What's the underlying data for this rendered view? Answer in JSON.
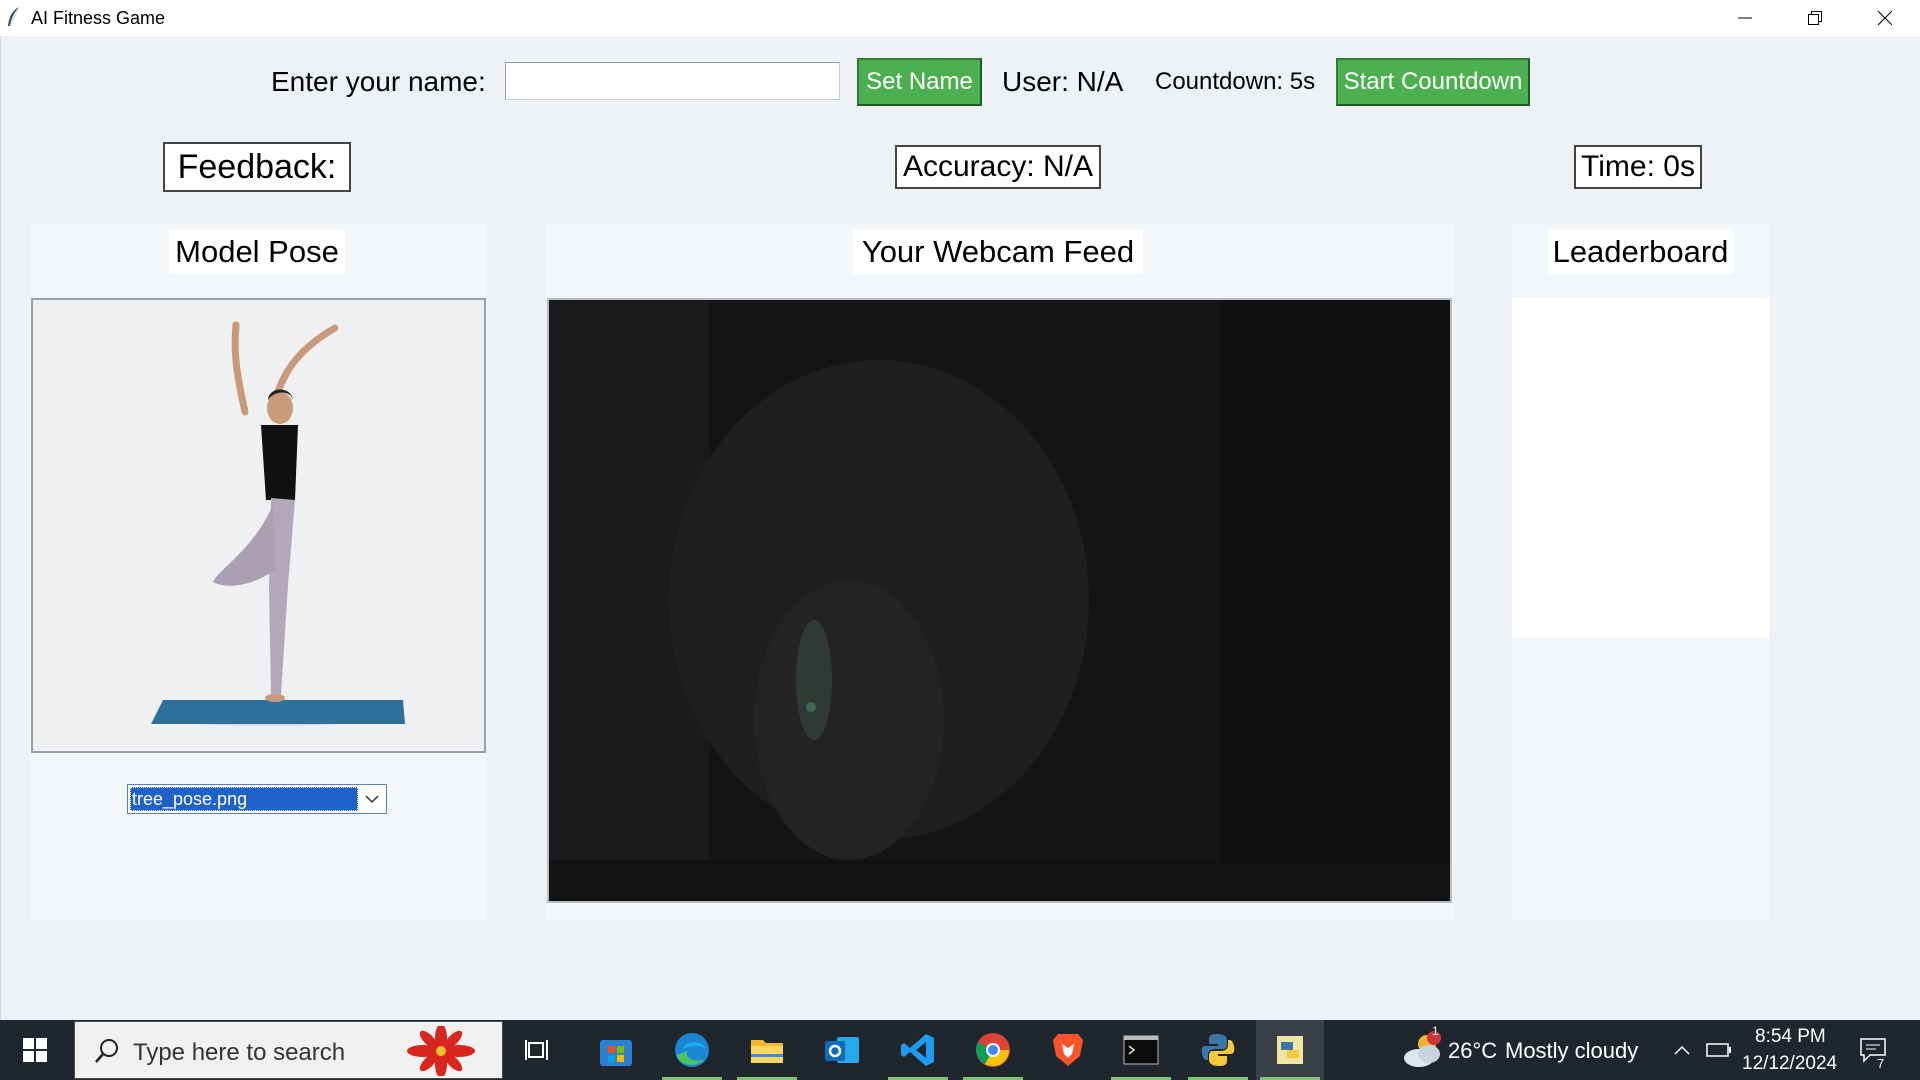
{
  "window": {
    "title": "AI Fitness Game"
  },
  "controls": {
    "name_label": "Enter your name:",
    "name_input_value": "",
    "set_name_label": "Set Name",
    "user_label": "User: N/A",
    "countdown_label": "Countdown: 5s",
    "start_countdown_label": "Start Countdown"
  },
  "stats": {
    "feedback": "Feedback:",
    "accuracy": "Accuracy: N/A",
    "time": "Time: 0s"
  },
  "panels": {
    "model_pose_title": "Model Pose",
    "webcam_title": "Your Webcam Feed",
    "leaderboard_title": "Leaderboard",
    "pose_select_value": "tree_pose.png",
    "leaderboard_entries": []
  },
  "taskbar": {
    "search_placeholder": "Type here to search",
    "apps": [
      "task-view",
      "microsoft-store",
      "edge",
      "file-explorer",
      "outlook",
      "vscode",
      "chrome",
      "brave",
      "terminal",
      "python",
      "python-idle"
    ],
    "weather_temp": "26°C",
    "weather_desc": "Mostly cloudy",
    "weather_badge": "1",
    "time": "8:54 PM",
    "date": "12/12/2024",
    "notification_count": "7"
  },
  "colors": {
    "accent_green": "#4caf50",
    "selection_blue": "#1e62c9",
    "taskbar": "#20262d"
  }
}
